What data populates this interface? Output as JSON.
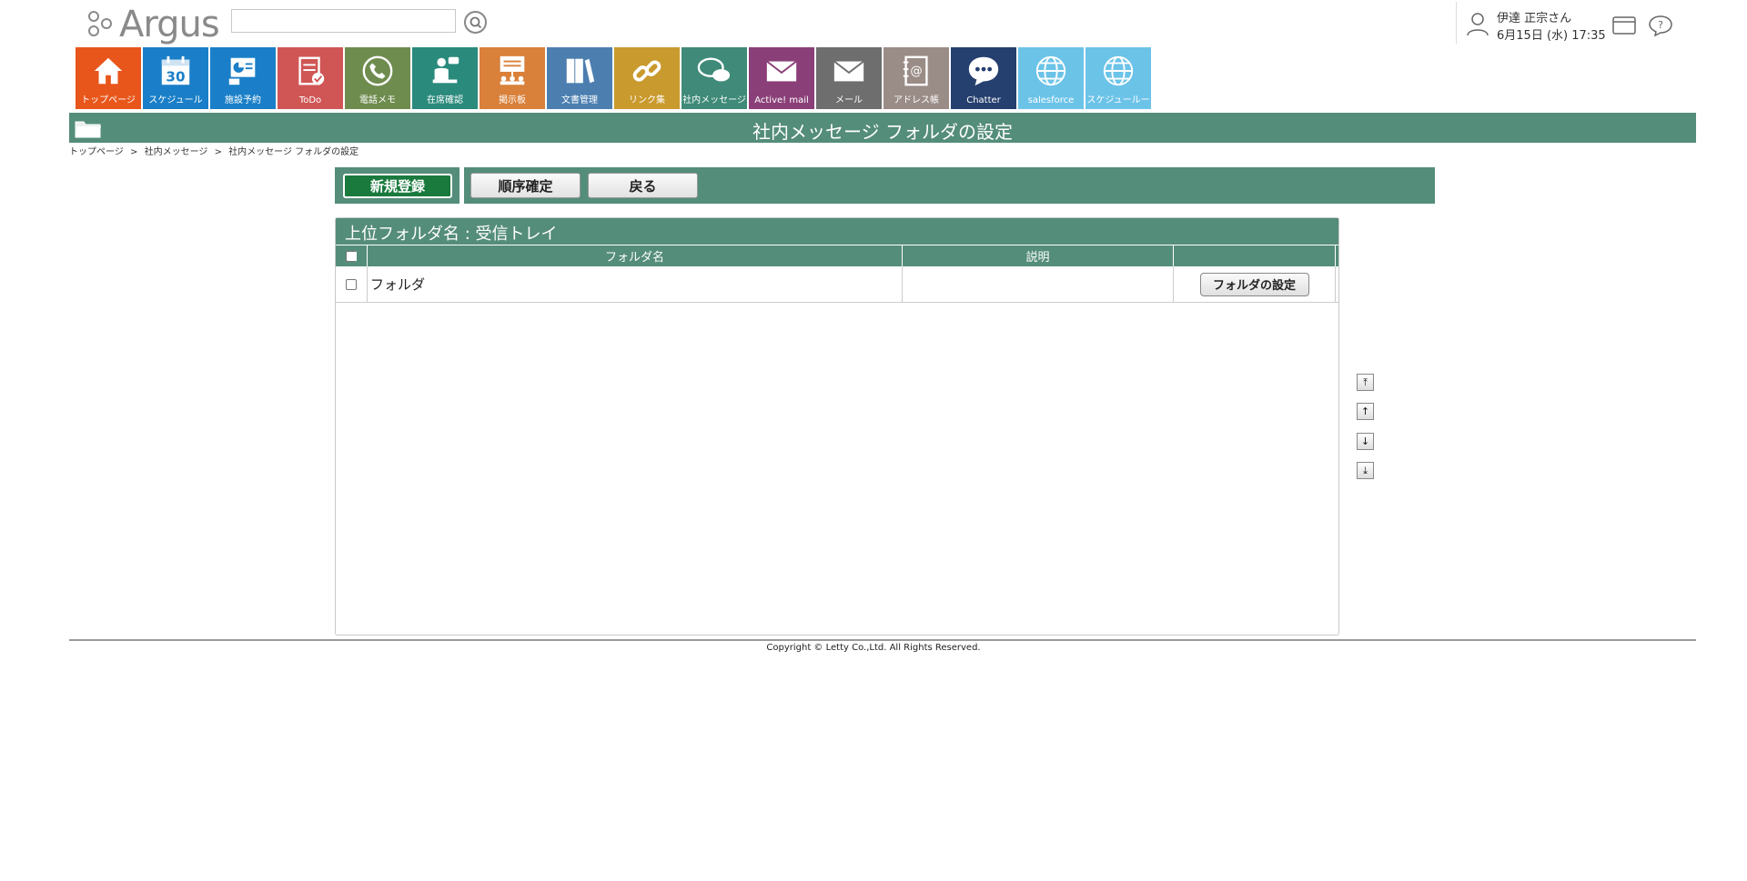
{
  "app": {
    "logo_text": "Argus",
    "search": {
      "value": "",
      "placeholder": ""
    }
  },
  "user": {
    "name": "伊達 正宗さん",
    "datetime": "6月15日 (水) 17:35"
  },
  "nav": [
    {
      "label": "トップページ",
      "color": "#e8561b",
      "icon": "home-icon"
    },
    {
      "label": "スケジュール",
      "color": "#1a7fc8",
      "icon": "calendar-icon",
      "badge": "30"
    },
    {
      "label": "施設予約",
      "color": "#1a7fc8",
      "icon": "facility-icon"
    },
    {
      "label": "ToDo",
      "color": "#d05656",
      "icon": "todo-icon"
    },
    {
      "label": "電話メモ",
      "color": "#6f8c4f",
      "icon": "phone-icon"
    },
    {
      "label": "在席確認",
      "color": "#2a8a7c",
      "icon": "presence-icon"
    },
    {
      "label": "掲示板",
      "color": "#d9803a",
      "icon": "board-icon"
    },
    {
      "label": "文書管理",
      "color": "#4c7fb0",
      "icon": "document-icon"
    },
    {
      "label": "リンク集",
      "color": "#c99a2e",
      "icon": "link-icon"
    },
    {
      "label": "社内メッセージ",
      "color": "#3f8a78",
      "icon": "message-icon"
    },
    {
      "label": "Active! mail",
      "color": "#8a3f78",
      "icon": "envelope-icon"
    },
    {
      "label": "メール",
      "color": "#6e6e6e",
      "icon": "mail-icon"
    },
    {
      "label": "アドレス帳",
      "color": "#9a8c86",
      "icon": "address-book-icon"
    },
    {
      "label": "Chatter",
      "color": "#253f6e",
      "icon": "chat-bubble-icon"
    },
    {
      "label": "salesforce",
      "color": "#6cc3e8",
      "icon": "globe-icon"
    },
    {
      "label": "スケジュールー",
      "color": "#6cc3e8",
      "icon": "globe-icon"
    }
  ],
  "page": {
    "title": "社内メッセージ フォルダの設定",
    "breadcrumb": [
      "トップページ",
      ">",
      "社内メッセージ",
      ">",
      "社内メッセージ フォルダの設定"
    ]
  },
  "toolbar": {
    "new_label": "新規登録",
    "order_label": "順序確定",
    "back_label": "戻る"
  },
  "panel": {
    "heading": "上位フォルダ名 : 受信トレイ",
    "columns": {
      "name": "フォルダ名",
      "description": "説明",
      "action": ""
    },
    "rows": [
      {
        "name": "フォルダ",
        "description": "",
        "action_label": "フォルダの設定"
      }
    ]
  },
  "move_buttons": [
    "⤒",
    "↑",
    "↓",
    "⤓"
  ],
  "footer": {
    "copyright": "Copyright © Letty Co.,Ltd. All Rights Reserved."
  }
}
